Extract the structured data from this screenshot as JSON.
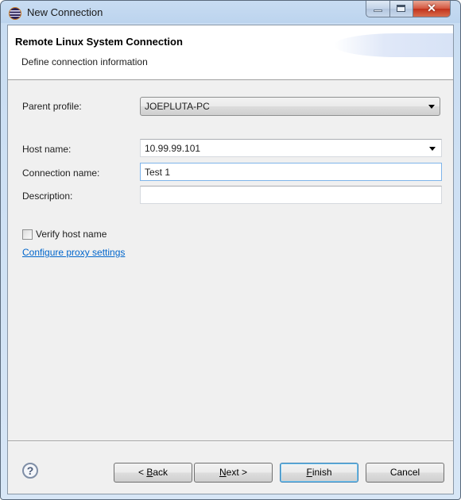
{
  "window": {
    "title": "New Connection",
    "icon": "eclipse-icon",
    "controls": {
      "minimize": "minimize",
      "maximize": "maximize",
      "close": "✕"
    }
  },
  "banner": {
    "title": "Remote Linux System Connection",
    "description": "Define connection information"
  },
  "form": {
    "parent_profile": {
      "label": "Parent profile:",
      "value": "JOEPLUTA-PC"
    },
    "host_name": {
      "label": "Host name:",
      "value": "10.99.99.101"
    },
    "connection_name": {
      "label": "Connection name:",
      "value": "Test 1"
    },
    "description": {
      "label": "Description:",
      "value": ""
    },
    "verify_host_name": {
      "label": "Verify host name",
      "checked": false
    },
    "proxy_link": "Configure proxy settings"
  },
  "footer": {
    "help": "?",
    "back": {
      "pre": "< ",
      "mnemonic": "B",
      "post": "ack"
    },
    "next": {
      "pre": "",
      "mnemonic": "N",
      "post": "ext >"
    },
    "finish": {
      "pre": "",
      "mnemonic": "F",
      "post": "inish"
    },
    "cancel": "Cancel"
  }
}
